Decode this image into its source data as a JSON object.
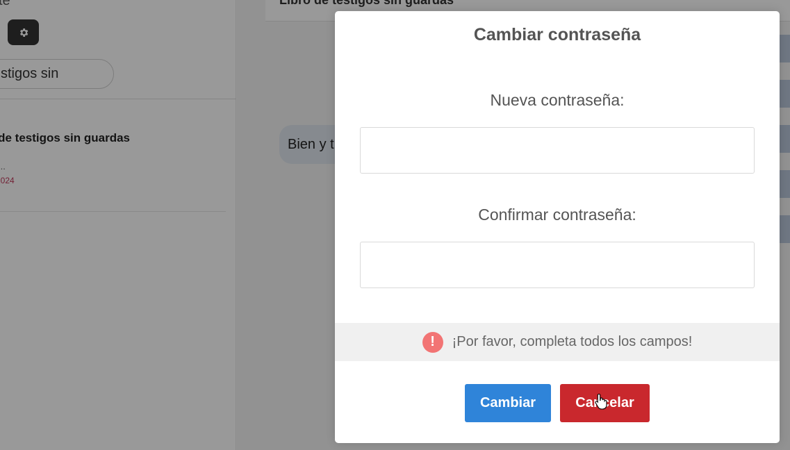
{
  "app": {
    "title_partial": "te",
    "search_value": "stigos sin"
  },
  "sidebar": {
    "chat": {
      "title": "o de testigos sin guardas",
      "preview": "...",
      "date": "2024"
    }
  },
  "main": {
    "header_title": "Libro de testigos sin guardas",
    "message_text": "Bien y t"
  },
  "modal": {
    "title": "Cambiar contraseña",
    "new_password_label": "Nueva contraseña:",
    "new_password_value": "",
    "confirm_password_label": "Confirmar contraseña:",
    "confirm_password_value": "",
    "validation_icon": "!",
    "validation_message": "¡Por favor, completa todos los campos!",
    "confirm_button": "Cambiar",
    "cancel_button": "Cancelar"
  },
  "colors": {
    "confirm_button": "#2f84d9",
    "cancel_button": "#c9282d",
    "validation_icon": "#f27474",
    "overlay": "rgba(0,0,0,0.40)"
  },
  "icons": {
    "settings": "gear-icon",
    "validation": "error-icon",
    "cursor": "hand-pointer-icon"
  }
}
